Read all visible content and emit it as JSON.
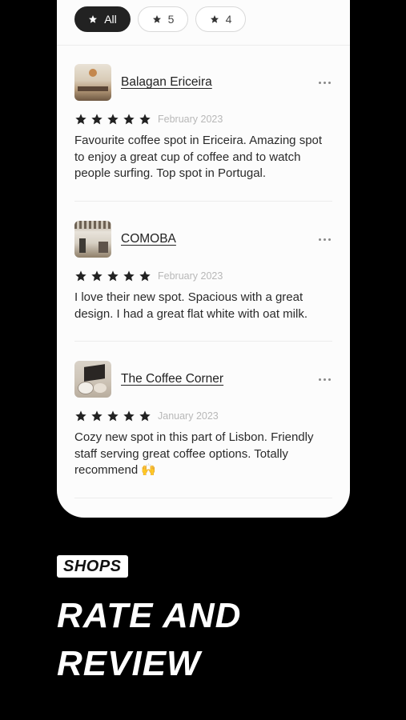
{
  "filters": [
    {
      "label": "All",
      "active": true
    },
    {
      "label": "5",
      "active": false
    },
    {
      "label": "4",
      "active": false
    }
  ],
  "reviews": [
    {
      "shop": "Balagan Ericeira",
      "stars": 5,
      "date": "February 2023",
      "text": "Favourite coffee spot in Ericeira. Amazing spot to enjoy a great cup of coffee and to watch people surfing. Top spot in Portugal."
    },
    {
      "shop": "COMOBA",
      "stars": 5,
      "date": "February 2023",
      "text": "I love their new spot. Spacious with a great design. I had a great flat white with oat milk."
    },
    {
      "shop": "The Coffee Corner",
      "stars": 5,
      "date": "January 2023",
      "text": "Cozy new spot in this part of Lisbon. Friendly staff serving great coffee options. Totally recommend 🙌"
    }
  ],
  "promo": {
    "badge": "SHOPS",
    "headline_line1": "RATE AND",
    "headline_line2": "REVIEW"
  },
  "colors": {
    "background": "#000000",
    "card": "#fcfcfc",
    "star": "#222222",
    "date": "#b8b8b8"
  }
}
